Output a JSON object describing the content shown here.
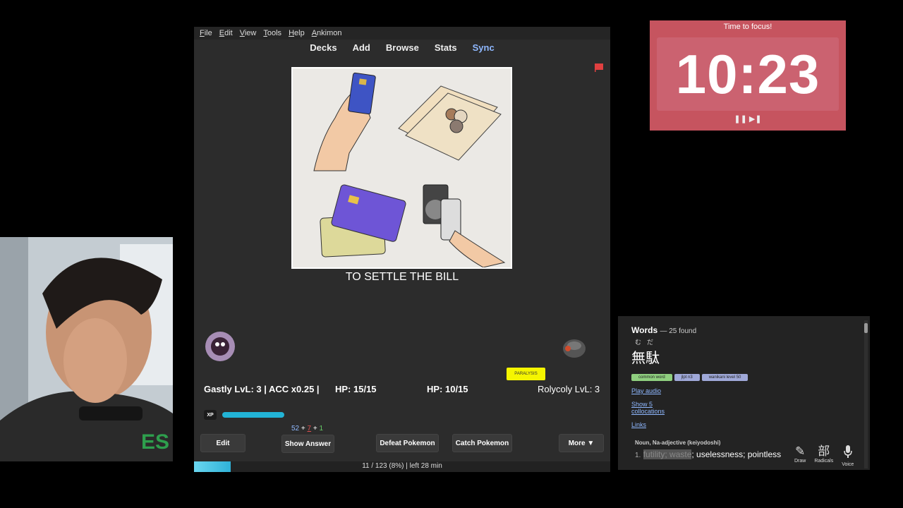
{
  "menu": [
    "File",
    "Edit",
    "View",
    "Tools",
    "Help",
    "Ankimon"
  ],
  "toplinks": {
    "decks": "Decks",
    "add": "Add",
    "browse": "Browse",
    "stats": "Stats",
    "sync": "Sync"
  },
  "card": {
    "text": "TO SETTLE THE BILL",
    "image_icon": "payment-methods-illustration"
  },
  "battle": {
    "player_stats": "Gastly LvL: 3 | ACC x0.25 |",
    "player_hp": "HP: 15/15",
    "enemy_hp": "HP: 10/15",
    "enemy_stats": "Rolycoly LvL: 3",
    "status": "PARALYSIS",
    "xp_label": "XP",
    "xp_progress": 0.22
  },
  "counts": {
    "new": "52",
    "plus1": "+",
    "learn": "7",
    "plus2": "+",
    "review": "1"
  },
  "buttons": {
    "edit": "Edit",
    "show_answer": "Show Answer",
    "defeat": "Defeat Pokemon",
    "catch": "Catch Pokemon",
    "more": "More ▼"
  },
  "progress": {
    "text": "11 / 123 (8%) | left 28 min",
    "fraction": 0.08
  },
  "timer": {
    "title": "Time to focus!",
    "time": "10:23",
    "controls": "❚❚ ▶❚"
  },
  "dict": {
    "heading": "Words",
    "found": "— 25 found",
    "reading": "むだ",
    "word": "無駄",
    "tags": [
      {
        "label": "common word",
        "color": "#8fcf7f"
      },
      {
        "label": "jlpt n3",
        "color": "#9fa8d8"
      },
      {
        "label": "wanikani level 50",
        "color": "#9fa8d8"
      }
    ],
    "play_audio": "Play audio",
    "show_collocations_1": "Show 5",
    "show_collocations_2": "collocations",
    "links": "Links",
    "pos": "Noun, Na-adjective (keiyodoshi)",
    "def_num": "1.",
    "def_highlight": "futility; waste",
    "def_rest": "; uselessness; pointless",
    "tools": {
      "draw": "Draw",
      "radicals": "Radicals",
      "voice": "Voice",
      "radicals_glyph": "部"
    }
  }
}
